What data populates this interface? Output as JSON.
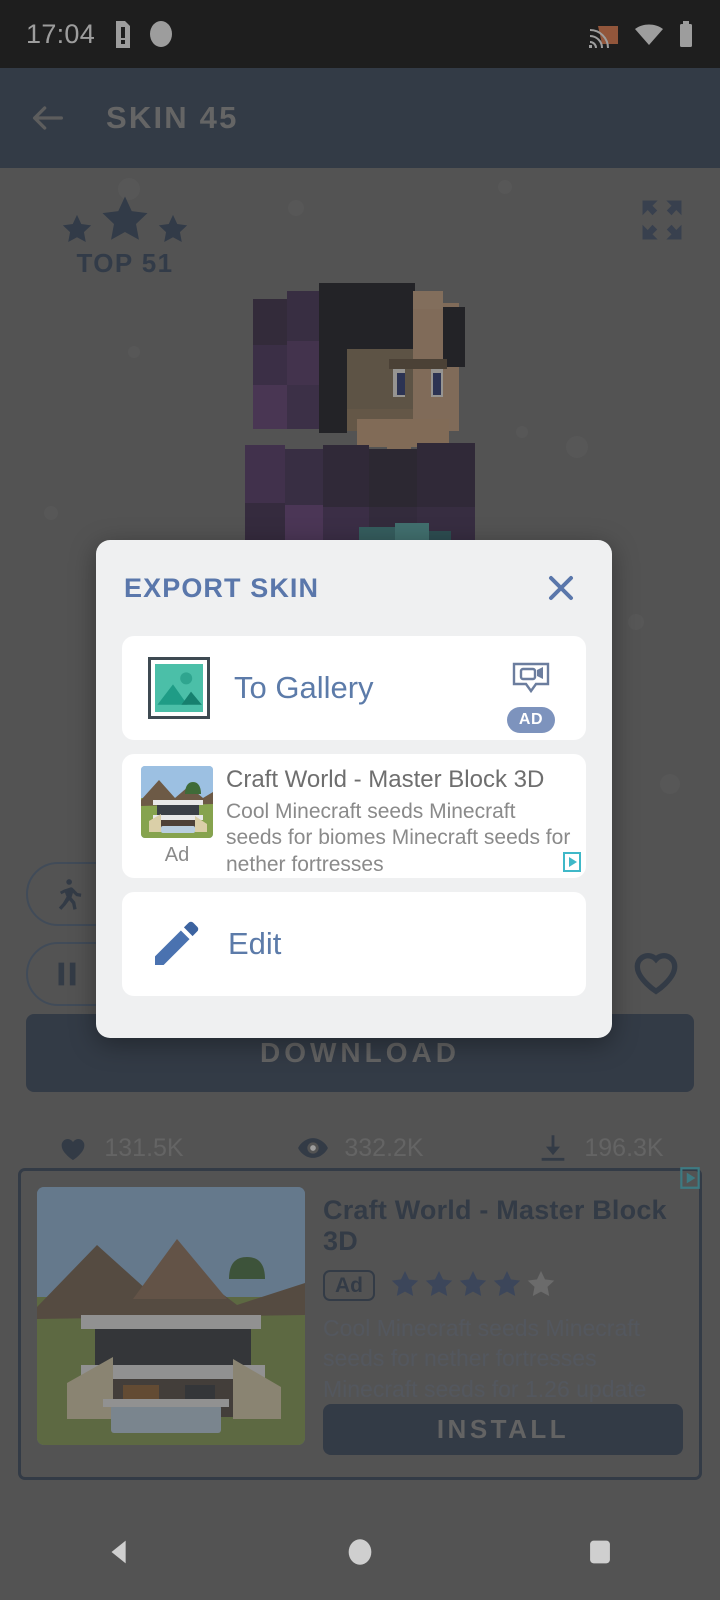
{
  "statusbar": {
    "time": "17:04",
    "icons": [
      "sim-alert-icon",
      "circle-icon",
      "cast-icon",
      "wifi-icon",
      "battery-icon"
    ]
  },
  "appbar": {
    "back_icon": "back-arrow-icon",
    "title": "SKIN 45"
  },
  "skin_page": {
    "top_badge_label": "TOP 51",
    "expand_icon": "fullscreen-expand-icon",
    "run_button_label": "R",
    "pause_button_label": "P",
    "favorite_icon": "heart-outline-icon",
    "download_label": "DOWNLOAD",
    "stats": [
      {
        "icon": "heart-icon",
        "value": "131.5K"
      },
      {
        "icon": "eye-icon",
        "value": "332.2K"
      },
      {
        "icon": "download-icon",
        "value": "196.3K"
      }
    ]
  },
  "bottom_ad": {
    "title": "Craft World - Master Block 3D",
    "ad_chip": "Ad",
    "rating_filled": 4,
    "rating_total": 5,
    "description": "Cool Minecraft seeds Minecraft seeds for nether fortresses Minecraft seeds for 1.26 update",
    "install_label": "INSTALL",
    "adchoices_icon": "adchoices-icon"
  },
  "dialog": {
    "title": "EXPORT SKIN",
    "close_icon": "close-icon",
    "options": [
      {
        "icon": "gallery-image-icon",
        "label": "To Gallery",
        "badge_icon": "video-ad-icon",
        "badge_label": "AD"
      },
      {
        "icon": "pencil-edit-icon",
        "label": "Edit"
      }
    ],
    "inline_ad": {
      "ad_label": "Ad",
      "title": "Craft World - Master Block 3D",
      "description": "Cool Minecraft seeds Minecraft seeds for biomes Minecraft seeds for nether fortresses",
      "adchoices_icon": "adchoices-icon"
    }
  },
  "navbar": {
    "back": "nav-back-icon",
    "home": "nav-home-icon",
    "recents": "nav-recents-icon"
  },
  "colors": {
    "navy": "#2b3a51",
    "dialog_blue": "#5a77ab",
    "teal": "#2fa58f",
    "scrim": "#6b6b6b"
  }
}
